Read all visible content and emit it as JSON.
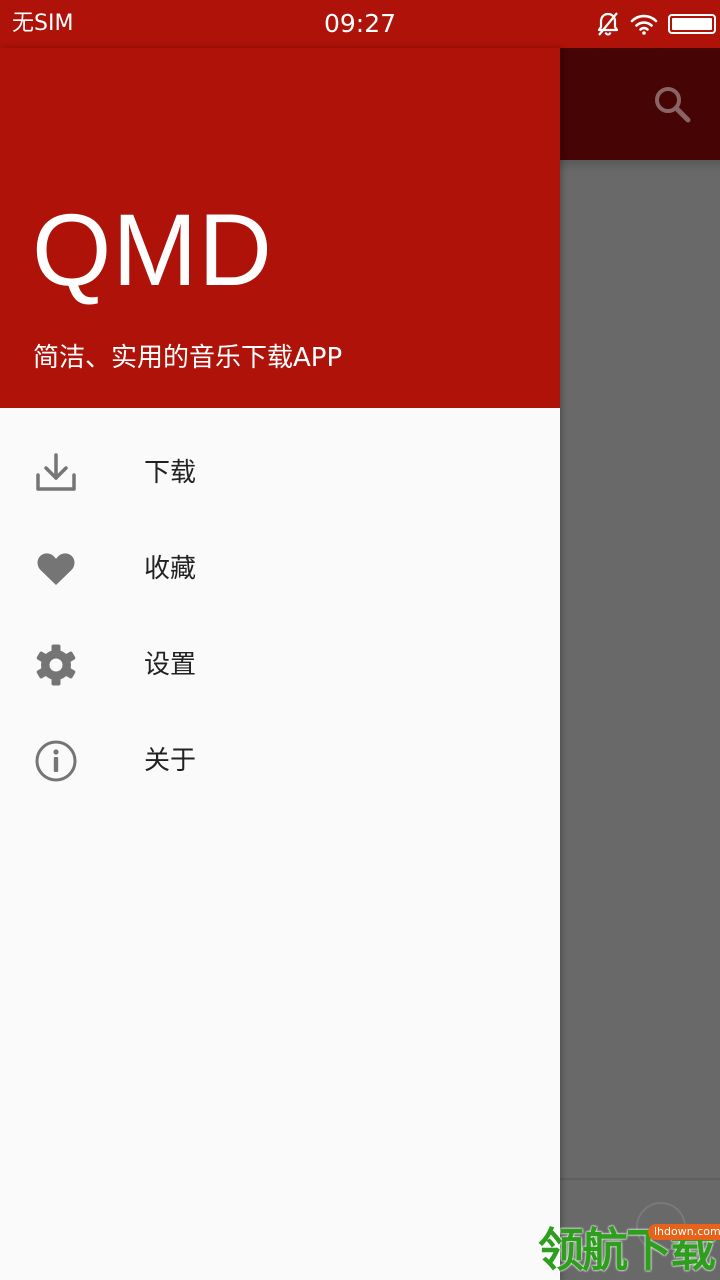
{
  "status_bar": {
    "carrier": "无SIM",
    "time": "09:27",
    "icons": [
      "bell-off-icon",
      "wifi-icon",
      "battery-icon"
    ]
  },
  "drawer": {
    "title": "QMD",
    "subtitle": "简洁、实用的音乐下载APP",
    "menu": [
      {
        "icon": "download-icon",
        "label": "下载"
      },
      {
        "icon": "heart-icon",
        "label": "收藏"
      },
      {
        "icon": "gear-icon",
        "label": "设置"
      },
      {
        "icon": "info-icon",
        "label": "关于"
      }
    ]
  },
  "background": {
    "toolbar_icon": "search-icon"
  },
  "watermark": {
    "text": "领航下载",
    "badge": "lhdown.com"
  },
  "colors": {
    "accent": "#ae1208",
    "toolbar_dimmed": "#460404",
    "scrim": "#696969",
    "drawer_bg": "#fafafa",
    "icon_gray": "#757575"
  }
}
